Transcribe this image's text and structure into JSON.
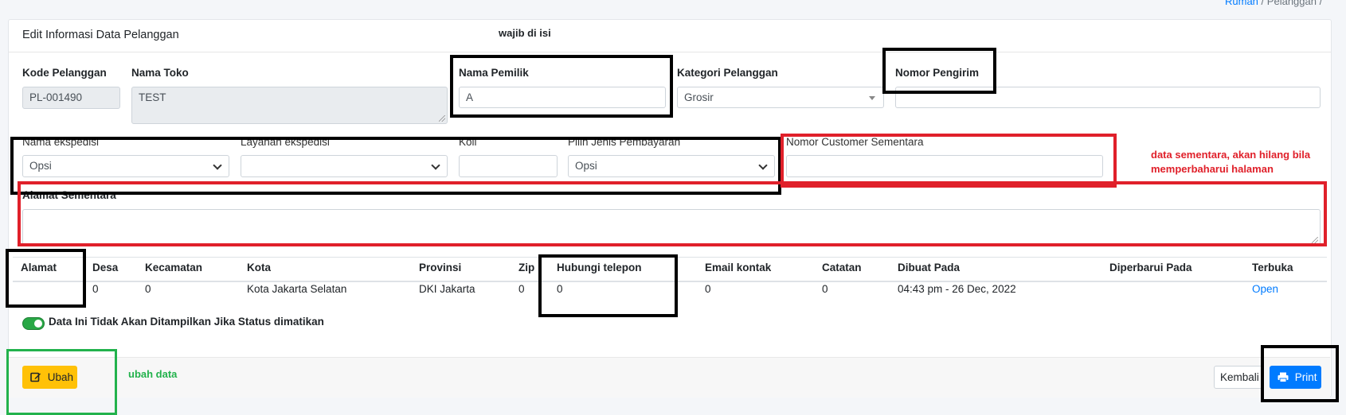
{
  "breadcrumb": {
    "home": "Rumah",
    "separator": "/",
    "current": "Pelanggan",
    "trail_sep": "/"
  },
  "card": {
    "title": "Edit Informasi Data Pelanggan"
  },
  "annotations": {
    "required": "wajib di isi",
    "temporary_line1": "data sementara, akan hilang bila",
    "temporary_line2": "memperbaharui halaman",
    "edit_data": "ubah data"
  },
  "form": {
    "kode_label": "Kode Pelanggan",
    "kode_value": "PL-001490",
    "nama_toko_label": "Nama Toko",
    "nama_toko_value": "TEST",
    "nama_pemilik_label": "Nama Pemilik",
    "nama_pemilik_value": "A",
    "kategori_label": "Kategori Pelanggan",
    "kategori_value": "Grosir",
    "nomor_pengirim_label": "Nomor Pengirim",
    "nomor_pengirim_value": "",
    "ekspedisi_label": "Nama ekspedisi",
    "ekspedisi_value": "Opsi",
    "layanan_label": "Layanan ekspedisi",
    "layanan_value": "",
    "koli_label": "Koli",
    "koli_value": "",
    "pembayaran_label": "Pilih Jenis Pembayaran",
    "pembayaran_value": "Opsi",
    "nomor_sementara_label": "Nomor Customer Sementara",
    "nomor_sementara_value": "",
    "alamat_sementara_label": "Alamat Sementara",
    "alamat_sementara_value": ""
  },
  "table": {
    "headers": [
      "Alamat",
      "Desa",
      "Kecamatan",
      "Kota",
      "Provinsi",
      "Zip",
      "Hubungi telepon",
      "Email kontak",
      "Catatan",
      "Dibuat Pada",
      "Diperbarui Pada",
      "Terbuka"
    ],
    "row": [
      "",
      "0",
      "0",
      "Kota Jakarta Selatan",
      "DKI Jakarta",
      "0",
      "0",
      "0",
      "0",
      "04:43 pm - 26 Dec, 2022",
      "",
      "Open"
    ]
  },
  "status_toggle": {
    "label": "Data Ini Tidak Akan Ditampilkan Jika Status dimatikan",
    "on": true
  },
  "buttons": {
    "edit": "Ubah",
    "back": "Kembali",
    "print": "Print"
  },
  "colors": {
    "warning": "#ffc107",
    "primary": "#007bff",
    "success": "#28a745",
    "annotation_red": "#e0202a",
    "annotation_green": "#22b24c"
  }
}
